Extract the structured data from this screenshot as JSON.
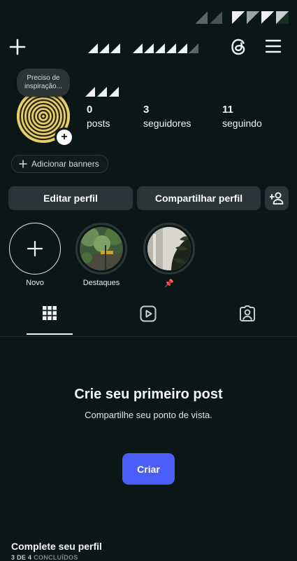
{
  "header": {
    "menu_icon": "hamburger-icon",
    "threads_icon": "threads-icon",
    "add_icon": "plus-icon"
  },
  "profile": {
    "note": "Preciso de inspiração...",
    "stats": [
      {
        "value": "0",
        "label": "posts"
      },
      {
        "value": "3",
        "label": "seguidores"
      },
      {
        "value": "11",
        "label": "seguindo"
      }
    ],
    "add_banners": "Adicionar banners"
  },
  "actions": {
    "edit": "Editar perfil",
    "share": "Compartilhar perfil"
  },
  "highlights": [
    {
      "label": "Novo"
    },
    {
      "label": "Destaques"
    },
    {
      "label": "📌"
    }
  ],
  "tabs": [
    "grid-icon",
    "reels-icon",
    "tagged-icon"
  ],
  "empty_state": {
    "title": "Crie seu primeiro post",
    "subtitle": "Compartilhe seu ponto de vista.",
    "button": "Criar"
  },
  "complete_profile": {
    "title": "Complete seu perfil",
    "progress_count": "3 DE 4",
    "progress_label": "CONCLUÍDOS"
  },
  "colors": {
    "background": "#0b1717",
    "button_bg": "#2b3436",
    "primary": "#4a5df9"
  }
}
